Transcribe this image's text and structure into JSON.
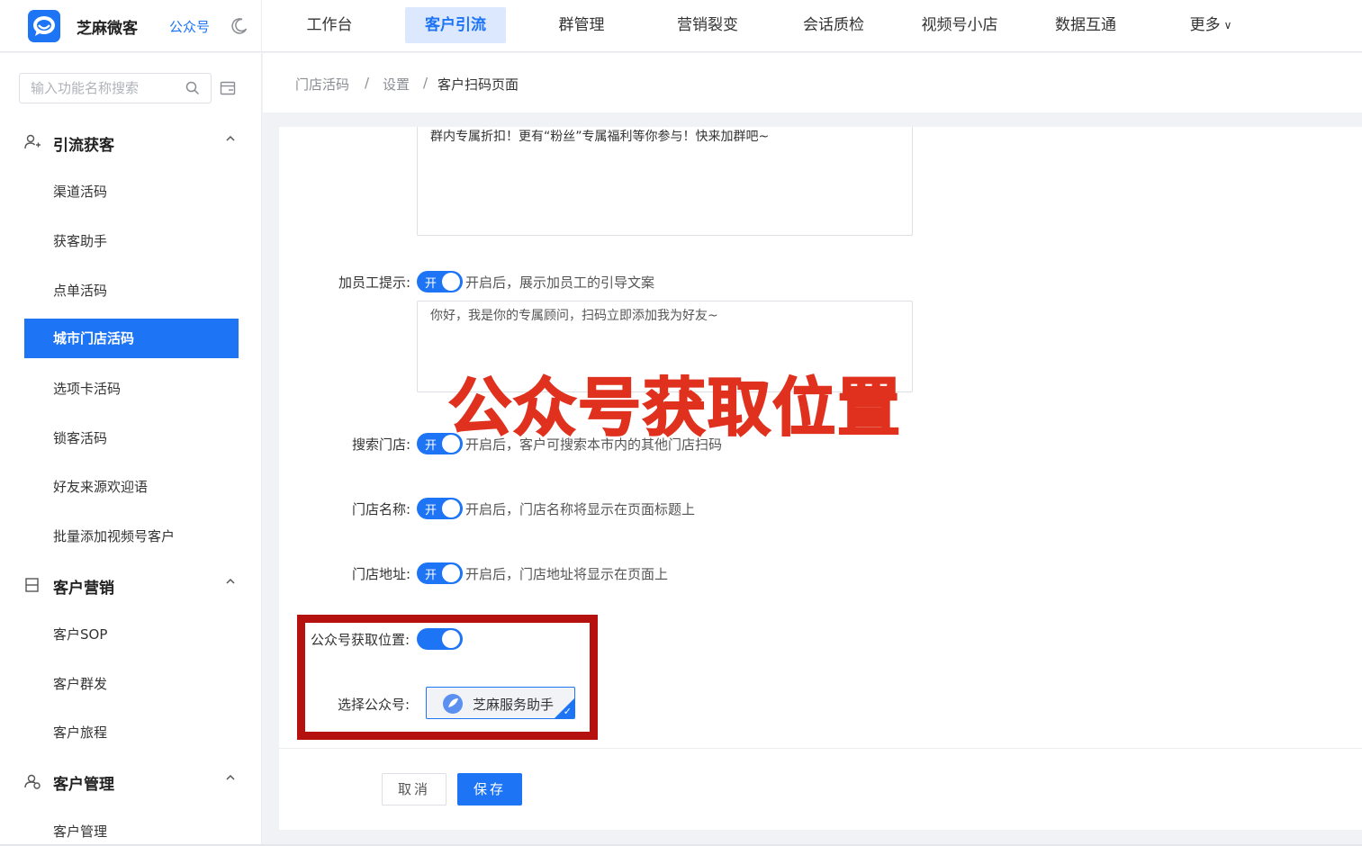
{
  "header": {
    "app_name": "芝麻微客",
    "account_link": "公众号",
    "nav": [
      {
        "label": "工作台"
      },
      {
        "label": "客户引流"
      },
      {
        "label": "群管理"
      },
      {
        "label": "营销裂变"
      },
      {
        "label": "会话质检"
      },
      {
        "label": "视频号小店"
      },
      {
        "label": "数据互通"
      },
      {
        "label": "更多"
      }
    ],
    "active_nav": "客户引流",
    "brand_color": "#1d74f5"
  },
  "sidebar": {
    "search_placeholder": "输入功能名称搜索",
    "groups": [
      {
        "title": "引流获客",
        "icon": "user-add-icon",
        "items": [
          {
            "label": "渠道活码"
          },
          {
            "label": "获客助手"
          },
          {
            "label": "点单活码"
          },
          {
            "label": "城市门店活码"
          },
          {
            "label": "选项卡活码"
          },
          {
            "label": "锁客活码"
          },
          {
            "label": "好友来源欢迎语"
          },
          {
            "label": "批量添加视频号客户"
          }
        ]
      },
      {
        "title": "客户营销",
        "icon": "calendar-icon",
        "items": [
          {
            "label": "客户SOP"
          },
          {
            "label": "客户群发"
          },
          {
            "label": "客户旅程"
          }
        ]
      },
      {
        "title": "客户管理",
        "icon": "customer-manage-icon",
        "items": [
          {
            "label": "客户管理"
          }
        ]
      }
    ],
    "active_item": "城市门店活码"
  },
  "breadcrumb": {
    "items": [
      "门店活码",
      "设置",
      "客户扫码页面"
    ],
    "separator": "/"
  },
  "form": {
    "top_textarea_text": "群内专属折扣！更有“粉丝”专属福利等你参与！快来加群吧~",
    "staff_tip": {
      "label": "加员工提示:",
      "switch_text": "开",
      "hint": "开启后，展示加员工的引导文案",
      "textarea_value": "你好，我是你的专属顾问，扫码立即添加我为好友~"
    },
    "search_store": {
      "label": "搜索门店:",
      "switch_text": "开",
      "hint": "开启后，客户可搜索本市内的其他门店扫码"
    },
    "store_name": {
      "label": "门店名称:",
      "switch_text": "开",
      "hint": "开启后，门店名称将显示在页面标题上"
    },
    "store_address": {
      "label": "门店地址:",
      "switch_text": "开",
      "hint": "开启后，门店地址将显示在页面上"
    },
    "oa_location": {
      "label": "公众号获取位置:"
    },
    "select_account": {
      "label": "选择公众号:",
      "account_name": "芝麻服务助手"
    },
    "overlay_caption": "公众号获取位置",
    "highlight_color": "#b5120f",
    "overlay_color": "#e0301e"
  },
  "footer": {
    "cancel_label": "取消",
    "save_label": "保存"
  }
}
